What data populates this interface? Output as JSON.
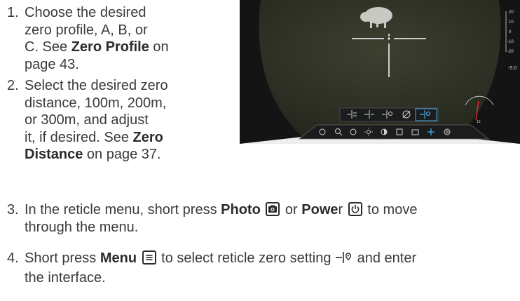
{
  "steps": [
    {
      "num": "1.",
      "lines": [
        "Choose the desired",
        "zero profile, A, B, or",
        "C. See ",
        "Zero Profile",
        " on",
        "page 43."
      ]
    },
    {
      "num": "2.",
      "lines": [
        "Select the desired zero",
        "distance, 100m, 200m,",
        "or 300m, and adjust",
        "it, if desired. See ",
        "Zero",
        "Distance",
        " on page 37."
      ]
    },
    {
      "num": "3.",
      "a": "In the reticle menu, short press ",
      "photo": "Photo",
      "or": " or ",
      "power_bold": "Powe",
      "power_rest": "r",
      "b": " to move",
      "c": "through the menu."
    },
    {
      "num": "4.",
      "a": "Short press ",
      "menu": "Menu",
      "b": " to select reticle zero setting ",
      "c": " and enter",
      "d": "the interface."
    }
  ],
  "scope": {
    "scale_labels": [
      "20",
      "10",
      "0",
      "-10",
      "-20"
    ],
    "readout": "-5.0",
    "gauge_value": "15",
    "gauge_ticks": [
      "-30",
      "-15",
      "0",
      "15",
      "30"
    ]
  }
}
